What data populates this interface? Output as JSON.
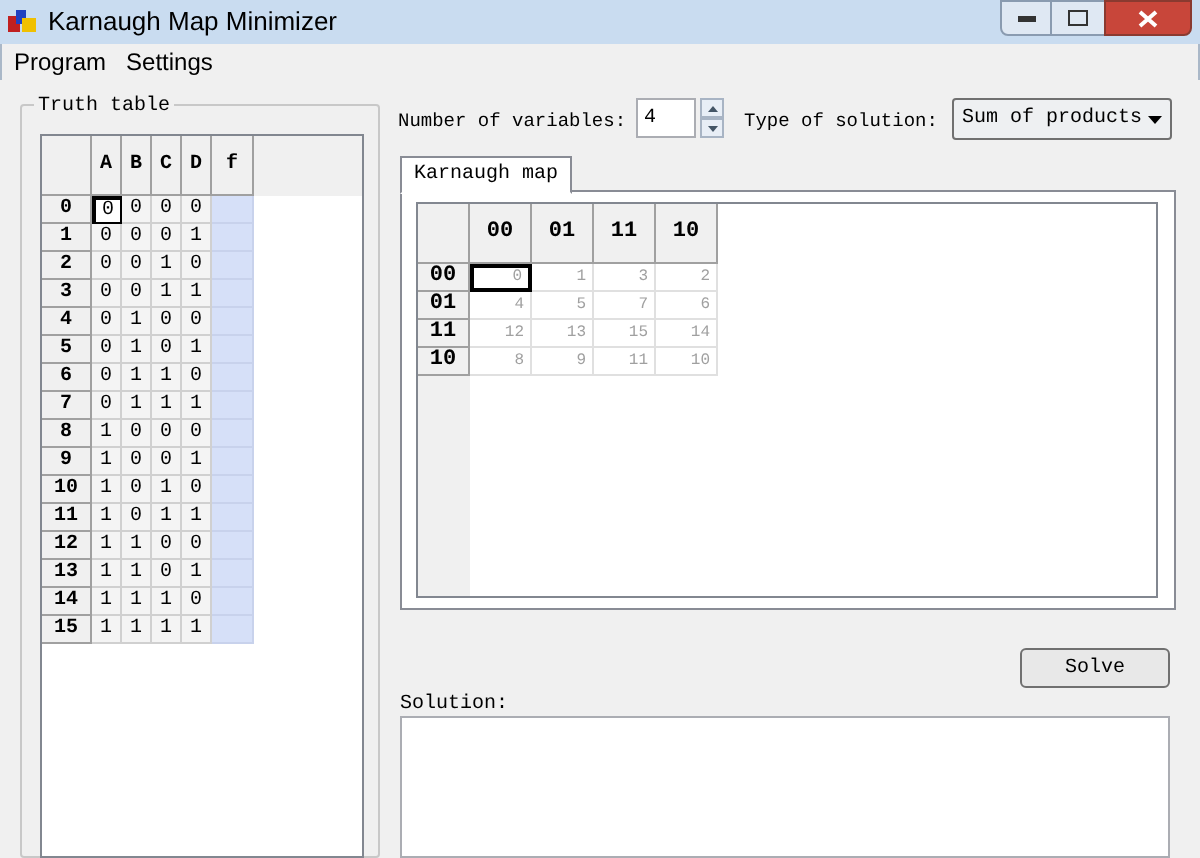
{
  "window": {
    "title": "Karnaugh Map Minimizer"
  },
  "menu": [
    "Program",
    "Settings"
  ],
  "truth_table": {
    "title": "Truth table",
    "columns": [
      "A",
      "B",
      "C",
      "D",
      "f"
    ],
    "rows": [
      {
        "label": "0",
        "bits": [
          {
            "value": "0",
            "selected": true
          },
          {
            "value": "0",
            "selected": false
          },
          {
            "value": "0",
            "selected": false
          },
          {
            "value": "0",
            "selected": false
          }
        ]
      },
      {
        "label": "1",
        "bits": [
          {
            "value": "0",
            "selected": false
          },
          {
            "value": "0",
            "selected": false
          },
          {
            "value": "0",
            "selected": false
          },
          {
            "value": "1",
            "selected": false
          }
        ]
      },
      {
        "label": "2",
        "bits": [
          {
            "value": "0",
            "selected": false
          },
          {
            "value": "0",
            "selected": false
          },
          {
            "value": "1",
            "selected": false
          },
          {
            "value": "0",
            "selected": false
          }
        ]
      },
      {
        "label": "3",
        "bits": [
          {
            "value": "0",
            "selected": false
          },
          {
            "value": "0",
            "selected": false
          },
          {
            "value": "1",
            "selected": false
          },
          {
            "value": "1",
            "selected": false
          }
        ]
      },
      {
        "label": "4",
        "bits": [
          {
            "value": "0",
            "selected": false
          },
          {
            "value": "1",
            "selected": false
          },
          {
            "value": "0",
            "selected": false
          },
          {
            "value": "0",
            "selected": false
          }
        ]
      },
      {
        "label": "5",
        "bits": [
          {
            "value": "0",
            "selected": false
          },
          {
            "value": "1",
            "selected": false
          },
          {
            "value": "0",
            "selected": false
          },
          {
            "value": "1",
            "selected": false
          }
        ]
      },
      {
        "label": "6",
        "bits": [
          {
            "value": "0",
            "selected": false
          },
          {
            "value": "1",
            "selected": false
          },
          {
            "value": "1",
            "selected": false
          },
          {
            "value": "0",
            "selected": false
          }
        ]
      },
      {
        "label": "7",
        "bits": [
          {
            "value": "0",
            "selected": false
          },
          {
            "value": "1",
            "selected": false
          },
          {
            "value": "1",
            "selected": false
          },
          {
            "value": "1",
            "selected": false
          }
        ]
      },
      {
        "label": "8",
        "bits": [
          {
            "value": "1",
            "selected": false
          },
          {
            "value": "0",
            "selected": false
          },
          {
            "value": "0",
            "selected": false
          },
          {
            "value": "0",
            "selected": false
          }
        ]
      },
      {
        "label": "9",
        "bits": [
          {
            "value": "1",
            "selected": false
          },
          {
            "value": "0",
            "selected": false
          },
          {
            "value": "0",
            "selected": false
          },
          {
            "value": "1",
            "selected": false
          }
        ]
      },
      {
        "label": "10",
        "bits": [
          {
            "value": "1",
            "selected": false
          },
          {
            "value": "0",
            "selected": false
          },
          {
            "value": "1",
            "selected": false
          },
          {
            "value": "0",
            "selected": false
          }
        ]
      },
      {
        "label": "11",
        "bits": [
          {
            "value": "1",
            "selected": false
          },
          {
            "value": "0",
            "selected": false
          },
          {
            "value": "1",
            "selected": false
          },
          {
            "value": "1",
            "selected": false
          }
        ]
      },
      {
        "label": "12",
        "bits": [
          {
            "value": "1",
            "selected": false
          },
          {
            "value": "1",
            "selected": false
          },
          {
            "value": "0",
            "selected": false
          },
          {
            "value": "0",
            "selected": false
          }
        ]
      },
      {
        "label": "13",
        "bits": [
          {
            "value": "1",
            "selected": false
          },
          {
            "value": "1",
            "selected": false
          },
          {
            "value": "0",
            "selected": false
          },
          {
            "value": "1",
            "selected": false
          }
        ]
      },
      {
        "label": "14",
        "bits": [
          {
            "value": "1",
            "selected": false
          },
          {
            "value": "1",
            "selected": false
          },
          {
            "value": "1",
            "selected": false
          },
          {
            "value": "0",
            "selected": false
          }
        ]
      },
      {
        "label": "15",
        "bits": [
          {
            "value": "1",
            "selected": false
          },
          {
            "value": "1",
            "selected": false
          },
          {
            "value": "1",
            "selected": false
          },
          {
            "value": "1",
            "selected": false
          }
        ]
      }
    ]
  },
  "variables": {
    "label": "Number of variables:",
    "value": "4"
  },
  "solution_type": {
    "label": "Type of solution:",
    "value": "Sum of products"
  },
  "tabs": [
    {
      "label": "Karnaugh map",
      "selected": true
    }
  ],
  "kmap": {
    "columns": [
      "00",
      "01",
      "11",
      "10"
    ],
    "rows": [
      {
        "label": "00",
        "cells": [
          {
            "value": "0",
            "selected": true
          },
          {
            "value": "1",
            "selected": false
          },
          {
            "value": "3",
            "selected": false
          },
          {
            "value": "2",
            "selected": false
          }
        ]
      },
      {
        "label": "01",
        "cells": [
          {
            "value": "4",
            "selected": false
          },
          {
            "value": "5",
            "selected": false
          },
          {
            "value": "7",
            "selected": false
          },
          {
            "value": "6",
            "selected": false
          }
        ]
      },
      {
        "label": "11",
        "cells": [
          {
            "value": "12",
            "selected": false
          },
          {
            "value": "13",
            "selected": false
          },
          {
            "value": "15",
            "selected": false
          },
          {
            "value": "14",
            "selected": false
          }
        ]
      },
      {
        "label": "10",
        "cells": [
          {
            "value": "8",
            "selected": false
          },
          {
            "value": "9",
            "selected": false
          },
          {
            "value": "11",
            "selected": false
          },
          {
            "value": "10",
            "selected": false
          }
        ]
      }
    ]
  },
  "solve_button": "Solve",
  "solution": {
    "label": "Solution:"
  }
}
